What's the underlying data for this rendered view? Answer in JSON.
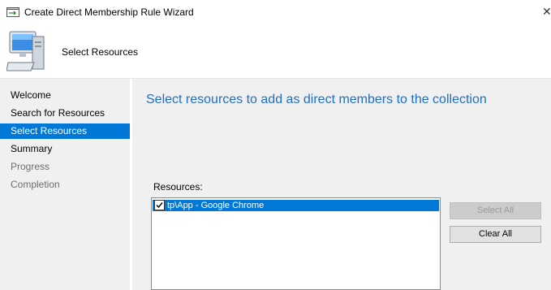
{
  "window": {
    "title": "Create Direct Membership Rule Wizard",
    "close_glyph": "✕"
  },
  "header": {
    "title": "Select Resources",
    "icon": "computer-icon"
  },
  "sidebar": {
    "items": [
      {
        "label": "Welcome",
        "state": "normal"
      },
      {
        "label": "Search for Resources",
        "state": "normal"
      },
      {
        "label": "Select Resources",
        "state": "selected"
      },
      {
        "label": "Summary",
        "state": "normal"
      },
      {
        "label": "Progress",
        "state": "disabled"
      },
      {
        "label": "Completion",
        "state": "disabled"
      }
    ]
  },
  "main": {
    "heading": "Select resources to add as direct members to the collection",
    "resources_label": "Resources:",
    "resources": [
      {
        "label": "tp\\App - Google Chrome",
        "checked": true,
        "selected": true
      }
    ],
    "buttons": {
      "select_all": "Select All",
      "clear_all": "Clear All"
    }
  },
  "colors": {
    "accent": "#0078d7",
    "heading": "#1e6fc4",
    "panel": "#f0f0f0"
  }
}
